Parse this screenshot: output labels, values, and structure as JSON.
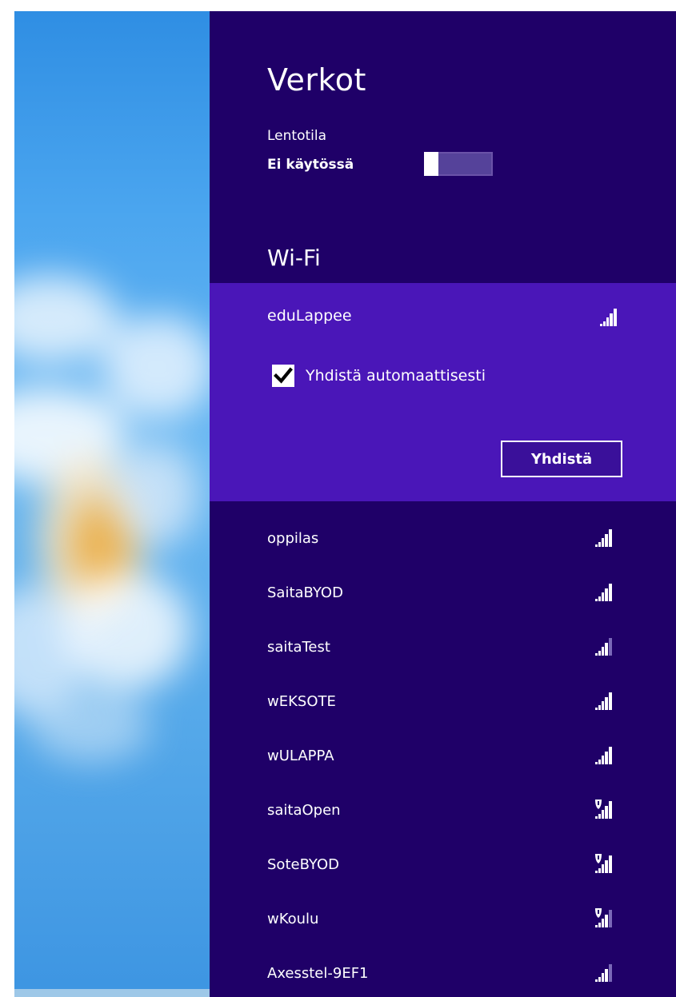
{
  "panel": {
    "title": "Verkot",
    "airplane_mode": {
      "label": "Lentotila",
      "state": "Ei käytössä",
      "on": false
    },
    "wifi_heading": "Wi-Fi"
  },
  "selected_network": {
    "ssid": "eduLappee",
    "signal_bars": 5,
    "secured": false,
    "auto_connect_label": "Yhdistä automaattisesti",
    "auto_connect_checked": true,
    "connect_label": "Yhdistä"
  },
  "networks": [
    {
      "ssid": "oppilas",
      "signal_bars": 5,
      "shield": false
    },
    {
      "ssid": "SaitaBYOD",
      "signal_bars": 5,
      "shield": false
    },
    {
      "ssid": "saitaTest",
      "signal_bars": 4,
      "shield": false
    },
    {
      "ssid": "wEKSOTE",
      "signal_bars": 5,
      "shield": false
    },
    {
      "ssid": "wULAPPA",
      "signal_bars": 5,
      "shield": false
    },
    {
      "ssid": "saitaOpen",
      "signal_bars": 5,
      "shield": true
    },
    {
      "ssid": "SoteBYOD",
      "signal_bars": 5,
      "shield": true
    },
    {
      "ssid": "wKoulu",
      "signal_bars": 4,
      "shield": true
    },
    {
      "ssid": "Axesstel-9EF1",
      "signal_bars": 4,
      "shield": false
    }
  ],
  "colors": {
    "panel_bg": "#1f0068",
    "selected_bg": "#4a16b8",
    "toggle_track": "#55429a",
    "signal_dim": "#7a68b8"
  }
}
